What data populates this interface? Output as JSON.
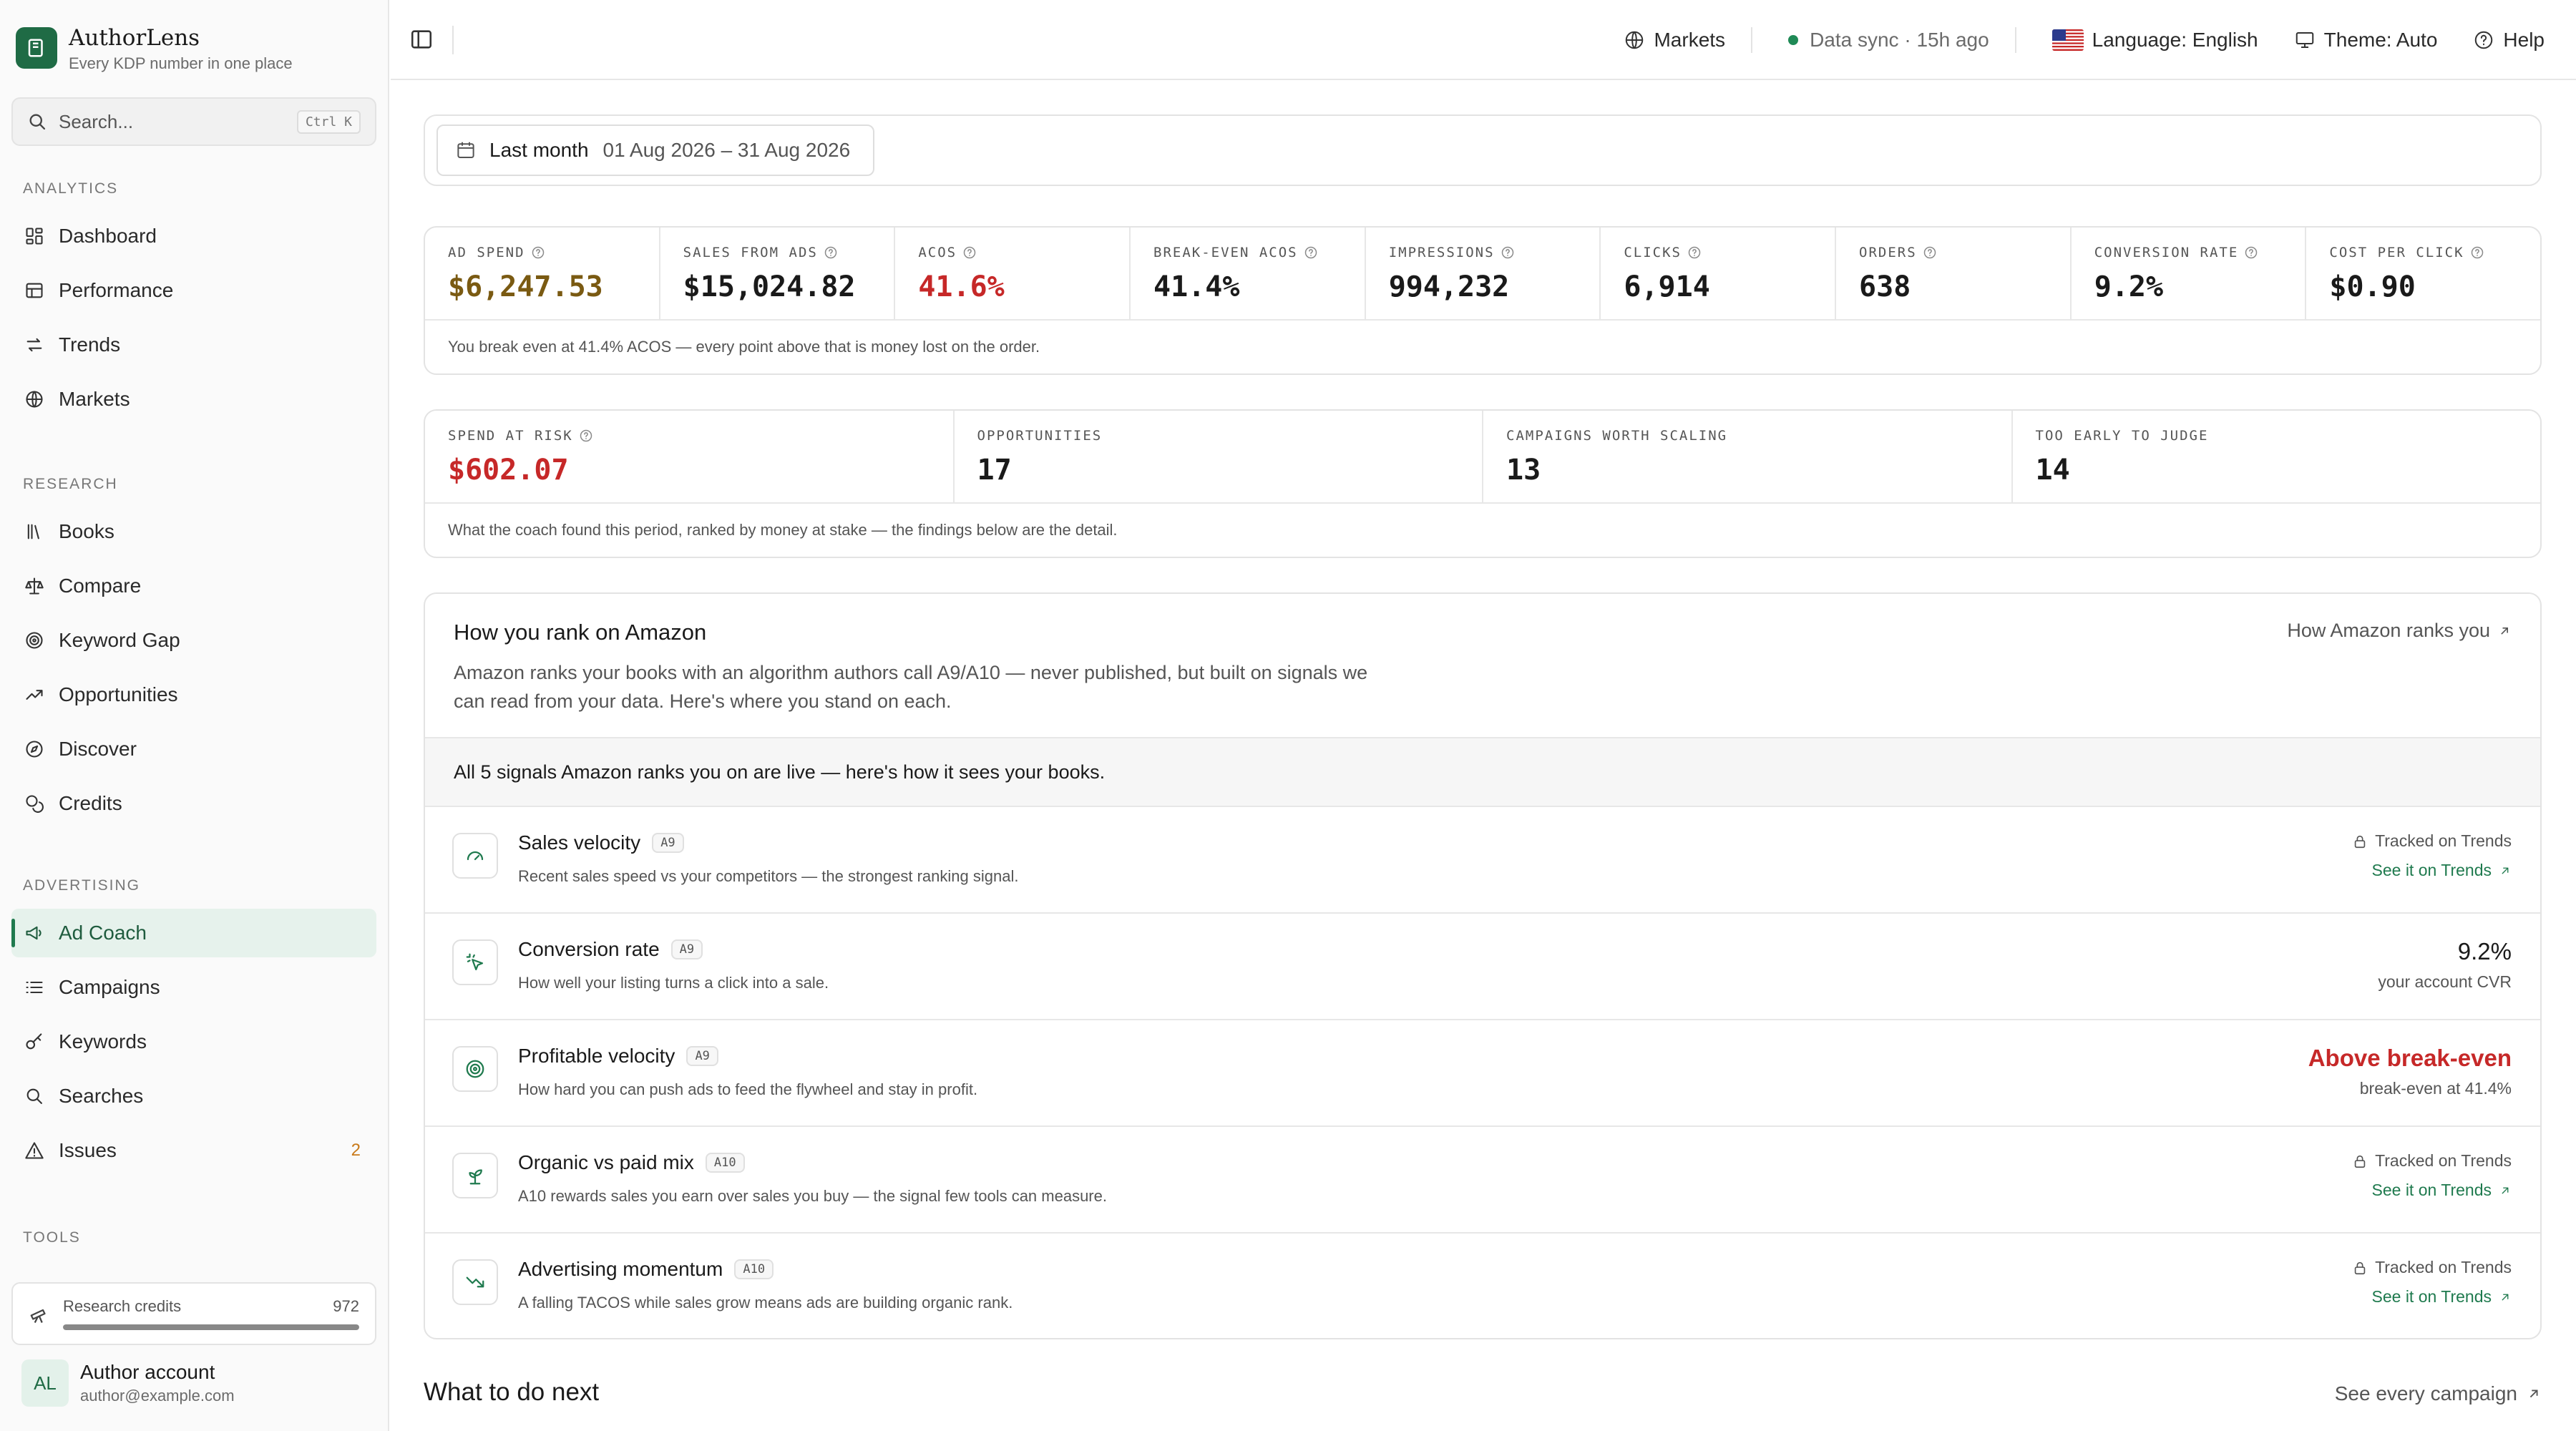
{
  "brand": {
    "name": "AuthorLens",
    "tagline": "Every KDP number in one place"
  },
  "search": {
    "placeholder": "Search...",
    "shortcut": "Ctrl K"
  },
  "sidebar": {
    "sections": [
      {
        "title": "ANALYTICS",
        "items": [
          {
            "label": "Dashboard",
            "icon": "dashboard-icon"
          },
          {
            "label": "Performance",
            "icon": "table-icon"
          },
          {
            "label": "Trends",
            "icon": "arrows-icon"
          },
          {
            "label": "Markets",
            "icon": "globe-icon"
          }
        ]
      },
      {
        "title": "RESEARCH",
        "items": [
          {
            "label": "Books",
            "icon": "library-icon"
          },
          {
            "label": "Compare",
            "icon": "scale-icon"
          },
          {
            "label": "Keyword Gap",
            "icon": "target-icon"
          },
          {
            "label": "Opportunities",
            "icon": "trending-up-icon"
          },
          {
            "label": "Discover",
            "icon": "compass-icon"
          },
          {
            "label": "Credits",
            "icon": "coins-icon"
          }
        ]
      },
      {
        "title": "ADVERTISING",
        "items": [
          {
            "label": "Ad Coach",
            "icon": "megaphone-icon",
            "active": true
          },
          {
            "label": "Campaigns",
            "icon": "list-icon"
          },
          {
            "label": "Keywords",
            "icon": "key-icon"
          },
          {
            "label": "Searches",
            "icon": "search-icon"
          },
          {
            "label": "Issues",
            "icon": "warning-icon",
            "badge": "2"
          }
        ]
      },
      {
        "title": "TOOLS",
        "items": []
      }
    ],
    "credits": {
      "label": "Research credits",
      "value": "972",
      "fill_fraction": 1.0
    },
    "account": {
      "initials": "AL",
      "name": "Author account",
      "email": "author@example.com"
    }
  },
  "topbar": {
    "markets": "Markets",
    "sync": "Data sync · 15h ago",
    "language": "Language: English",
    "theme": "Theme: Auto",
    "help": "Help"
  },
  "date_range": {
    "label": "Last month",
    "range": "01 Aug 2026 – 31 Aug 2026"
  },
  "kpis": [
    {
      "label": "AD SPEND",
      "value": "$6,247.53",
      "color": "#7a5a12",
      "help": true
    },
    {
      "label": "SALES FROM ADS",
      "value": "$15,024.82",
      "color": "#1a1a1a",
      "help": true
    },
    {
      "label": "ACOS",
      "value": "41.6%",
      "color": "#c62828",
      "help": true
    },
    {
      "label": "BREAK-EVEN ACOS",
      "value": "41.4%",
      "color": "#1a1a1a",
      "help": true
    },
    {
      "label": "IMPRESSIONS",
      "value": "994,232",
      "color": "#1a1a1a",
      "help": true
    },
    {
      "label": "CLICKS",
      "value": "6,914",
      "color": "#1a1a1a",
      "help": true
    },
    {
      "label": "ORDERS",
      "value": "638",
      "color": "#1a1a1a",
      "help": true
    },
    {
      "label": "CONVERSION RATE",
      "value": "9.2%",
      "color": "#1a1a1a",
      "help": true
    },
    {
      "label": "COST PER CLICK",
      "value": "$0.90",
      "color": "#1a1a1a",
      "help": true
    }
  ],
  "kpi_footer": "You break even at 41.4% ACOS — every point above that is money lost on the order.",
  "findings": [
    {
      "label": "SPEND AT RISK",
      "value": "$602.07",
      "color": "#c62828",
      "help": true
    },
    {
      "label": "OPPORTUNITIES",
      "value": "17",
      "color": "#1a1a1a",
      "help": false
    },
    {
      "label": "CAMPAIGNS WORTH SCALING",
      "value": "13",
      "color": "#1a1a1a",
      "help": false
    },
    {
      "label": "TOO EARLY TO JUDGE",
      "value": "14",
      "color": "#1a1a1a",
      "help": false
    }
  ],
  "findings_footer": "What the coach found this period, ranked by money at stake — the findings below are the detail.",
  "ranking": {
    "title": "How you rank on Amazon",
    "description": "Amazon ranks your books with an algorithm authors call A9/A10 — never published, but built on signals we can read from your data. Here's where you stand on each.",
    "link": "How Amazon ranks you",
    "banner": "All 5 signals Amazon ranks you on are live — here's how it sees your books.",
    "signals": [
      {
        "title": "Sales velocity",
        "tag": "A9",
        "desc": "Recent sales speed vs your competitors — the strongest ranking signal.",
        "icon": "gauge-icon",
        "kind": "tracked",
        "track": "Tracked on Trends",
        "link": "See it on Trends"
      },
      {
        "title": "Conversion rate",
        "tag": "A9",
        "desc": "How well your listing turns a click into a sale.",
        "icon": "click-icon",
        "kind": "value",
        "value": "9.2%",
        "sub": "your account CVR"
      },
      {
        "title": "Profitable velocity",
        "tag": "A9",
        "desc": "How hard you can push ads to feed the flywheel and stay in profit.",
        "icon": "target-icon",
        "kind": "warn",
        "value": "Above break-even",
        "sub": "break-even at 41.4%"
      },
      {
        "title": "Organic vs paid mix",
        "tag": "A10",
        "desc": "A10 rewards sales you earn over sales you buy — the signal few tools can measure.",
        "icon": "sprout-icon",
        "kind": "tracked",
        "track": "Tracked on Trends",
        "link": "See it on Trends"
      },
      {
        "title": "Advertising momentum",
        "tag": "A10",
        "desc": "A falling TACOS while sales grow means ads are building organic rank.",
        "icon": "trending-down-icon",
        "kind": "tracked",
        "track": "Tracked on Trends",
        "link": "See it on Trends"
      }
    ]
  },
  "next": {
    "title": "What to do next",
    "link": "See every campaign"
  }
}
